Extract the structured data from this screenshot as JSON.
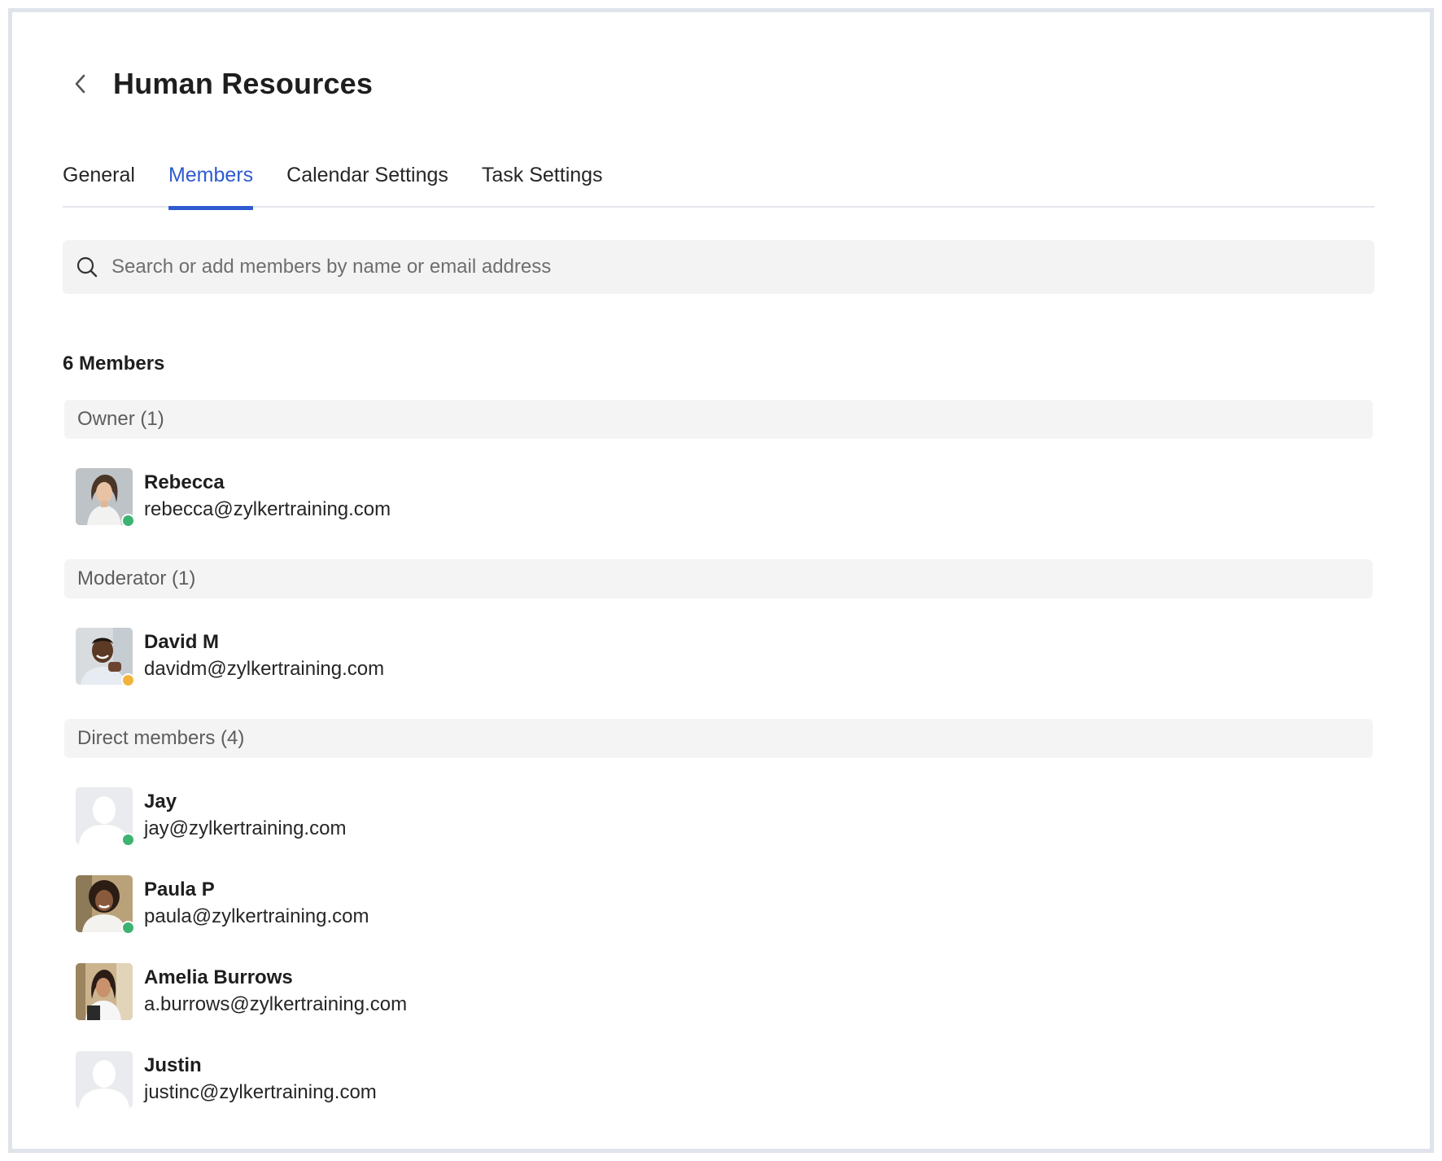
{
  "header": {
    "title": "Human Resources"
  },
  "tabs": [
    {
      "label": "General",
      "active": false
    },
    {
      "label": "Members",
      "active": true
    },
    {
      "label": "Calendar Settings",
      "active": false
    },
    {
      "label": "Task Settings",
      "active": false
    }
  ],
  "search": {
    "placeholder": "Search or add members by name or email address",
    "value": ""
  },
  "members_summary": "6 Members",
  "groups": {
    "owner": {
      "label": "Owner (1)",
      "members": [
        {
          "name": "Rebecca",
          "email": "rebecca@zylkertraining.com",
          "status": "online",
          "avatar": "photo"
        }
      ]
    },
    "moderator": {
      "label": "Moderator (1)",
      "members": [
        {
          "name": "David M",
          "email": "davidm@zylkertraining.com",
          "status": "away",
          "avatar": "photo"
        }
      ]
    },
    "direct": {
      "label": "Direct members (4)",
      "members": [
        {
          "name": "Jay",
          "email": "jay@zylkertraining.com",
          "status": "online",
          "avatar": "placeholder"
        },
        {
          "name": "Paula P",
          "email": "paula@zylkertraining.com",
          "status": "online",
          "avatar": "photo"
        },
        {
          "name": "Amelia Burrows",
          "email": "a.burrows@zylkertraining.com",
          "status": "none",
          "avatar": "photo"
        },
        {
          "name": "Justin",
          "email": "justinc@zylkertraining.com",
          "status": "none",
          "avatar": "placeholder"
        }
      ]
    }
  },
  "colors": {
    "accent": "#2f5bd0",
    "online": "#3cb371",
    "away": "#f0b43c",
    "group_bg": "#f4f4f5",
    "search_bg": "#f3f3f4"
  }
}
